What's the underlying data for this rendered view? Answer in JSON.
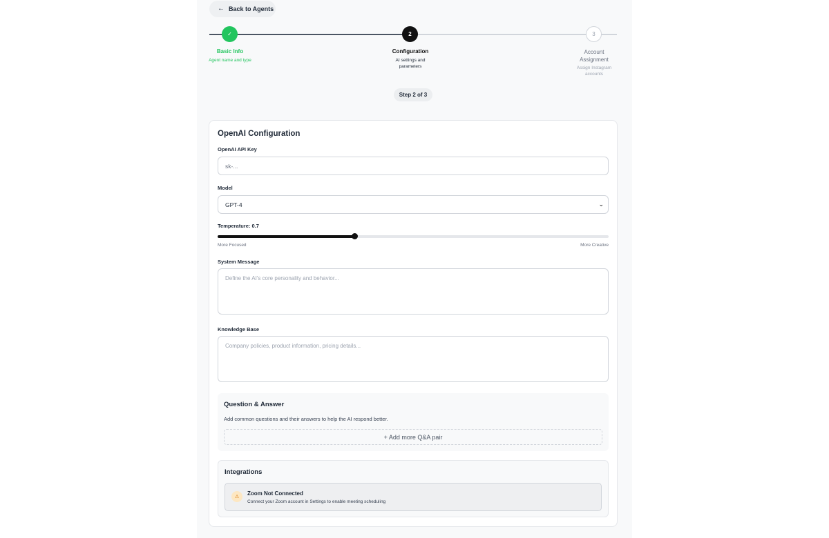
{
  "nav": {
    "back_label": "Back to Agents"
  },
  "stepper": {
    "steps": [
      {
        "number": "✓",
        "title": "Basic Info",
        "subtitle": "Agent name and type",
        "status": "complete"
      },
      {
        "number": "2",
        "title": "Configuration",
        "subtitle": "AI settings and parameters",
        "status": "current"
      },
      {
        "number": "3",
        "title": "Account Assignment",
        "subtitle": "Assign Instagram accounts",
        "status": "upcoming"
      }
    ],
    "badge": "Step 2 of 3"
  },
  "card": {
    "title": "OpenAI Configuration",
    "api_key": {
      "label": "OpenAI API Key",
      "placeholder": "sk-..."
    },
    "model": {
      "label": "Model",
      "value": "GPT-4"
    },
    "temperature": {
      "label": "Temperature: 0.7",
      "value": 0.7,
      "fraction": 0.35,
      "min_hint": "More Focused",
      "max_hint": "More Creative"
    },
    "system_message": {
      "label": "System Message",
      "placeholder": "Define the AI's core personality and behavior..."
    },
    "knowledge_base": {
      "label": "Knowledge Base",
      "placeholder": "Company policies, product information, pricing details..."
    }
  },
  "qa": {
    "title": "Question & Answer",
    "description": "Add common questions and their answers to help the AI respond better.",
    "add_label": "+ Add more Q&A pair"
  },
  "integrations": {
    "title": "Integrations",
    "zoom": {
      "icon": "warning-icon",
      "title": "Zoom Not Connected",
      "description": "Connect your Zoom account in Settings to enable meeting scheduling"
    }
  }
}
